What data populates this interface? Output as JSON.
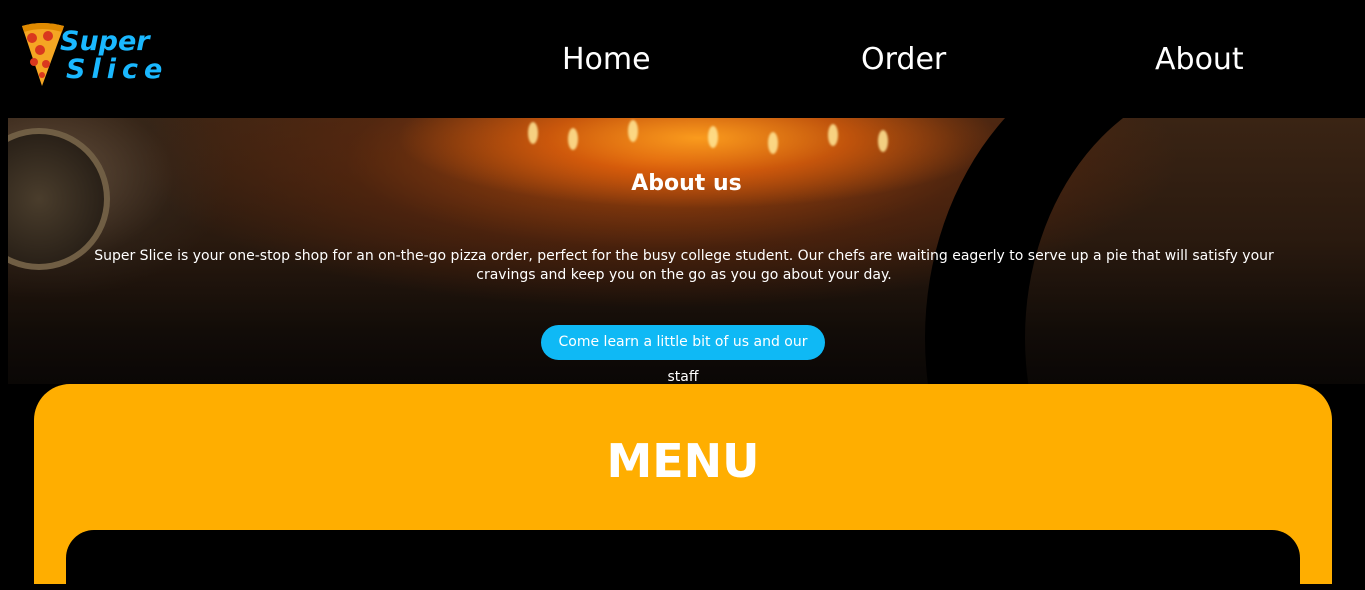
{
  "header": {
    "logo": {
      "line1": "Super",
      "line2": "Slice",
      "icon": "pizza-slice-icon"
    },
    "nav": [
      {
        "label": "Home"
      },
      {
        "label": "Order"
      },
      {
        "label": "About"
      }
    ]
  },
  "hero": {
    "title": "About us",
    "description": "Super Slice is your one-stop shop for an on-the-go pizza order, perfect for the busy college student. Our chefs are waiting eagerly to serve up a pie that will satisfy your cravings and keep you on the go as you go about your day.",
    "button_label": "Come learn a little bit of us and our staff"
  },
  "menu": {
    "title": "MENU"
  },
  "colors": {
    "background": "#000000",
    "accent_blue": "#0fb9f5",
    "menu_orange": "#ffae00",
    "text": "#ffffff"
  }
}
